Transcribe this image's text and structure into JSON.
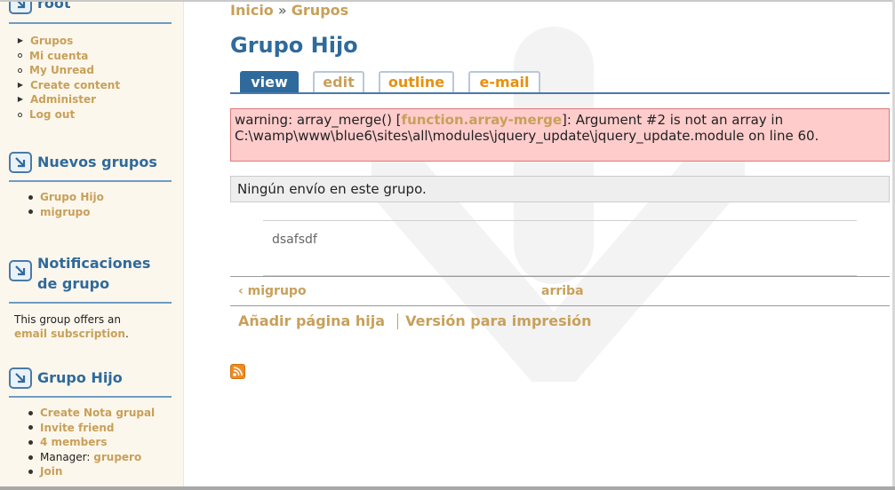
{
  "sidebar": {
    "user_block": {
      "title": "root",
      "items": [
        {
          "label": "Grupos",
          "bullet": "arrow"
        },
        {
          "label": "Mi cuenta",
          "bullet": "open"
        },
        {
          "label": "My Unread",
          "bullet": "open"
        },
        {
          "label": "Create content",
          "bullet": "arrow"
        },
        {
          "label": "Administer",
          "bullet": "arrow"
        },
        {
          "label": "Log out",
          "bullet": "open"
        }
      ]
    },
    "new_groups_block": {
      "title": "Nuevos grupos",
      "items": [
        "Grupo Hijo",
        "migrupo"
      ]
    },
    "notifications_block": {
      "title_line1": "Notificaciones",
      "title_line2": "de grupo",
      "text": "This group offers an",
      "link": "email subscription",
      "trailing": "."
    },
    "group_block": {
      "title": "Grupo Hijo",
      "items": [
        "Create Nota grupal",
        "Invite friend",
        "4 members"
      ],
      "manager_label": "Manager:",
      "manager_name": "grupero",
      "join_label": "Join"
    }
  },
  "breadcrumb": {
    "home": "Inicio",
    "separator": "»",
    "current": "Grupos"
  },
  "page": {
    "title": "Grupo Hijo",
    "tabs": [
      {
        "label": "view",
        "active": true
      },
      {
        "label": "edit"
      },
      {
        "label": "outline"
      },
      {
        "label": "e-mail"
      }
    ]
  },
  "warning": {
    "prefix": "warning: array_merge() [",
    "link": "function.array-merge",
    "suffix": "]: Argument #2 is not an array in C:\\wamp\\www\\blue6\\sites\\all\\modules\\jquery_update\\jquery_update.module on line 60."
  },
  "info_message": "Ningún envío en este grupo.",
  "description": "dsafsdf",
  "book_nav": {
    "prev": "‹ migrupo",
    "up": "arriba"
  },
  "links": {
    "add_child": "Añadir página hija",
    "print": "Versión para impresión"
  },
  "colors": {
    "link": "#c8a05a",
    "heading": "#2f6a9c",
    "tab_active_bg": "#2f6a9c",
    "tab_text": "#e8900c",
    "warning_bg": "#ffcccc",
    "sidebar_bg": "#fcf7ec"
  },
  "icons": {
    "block_icon": "arrow-down-right-icon",
    "feed_icon": "rss-icon"
  }
}
